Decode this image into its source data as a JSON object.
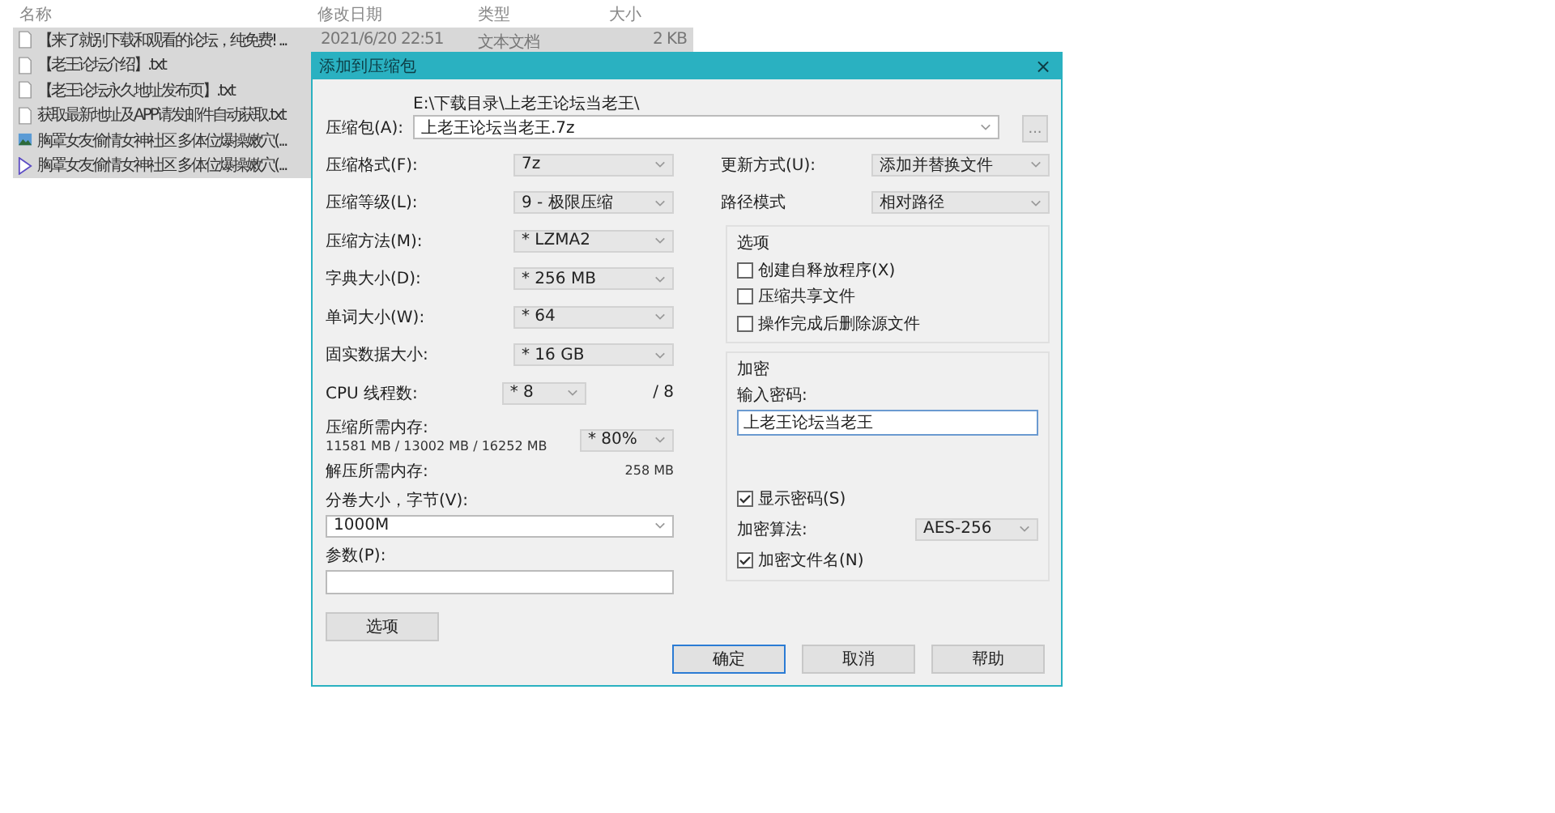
{
  "file_list": {
    "columns": [
      "名称",
      "修改日期",
      "类型",
      "大小"
    ],
    "rows": [
      {
        "name": "【来了就别下载和观看的论坛，纯免费! ...",
        "modified": "2021/6/20 22:51",
        "type": "文本文档",
        "size": "2 KB",
        "selected": true,
        "kind": "text"
      },
      {
        "name": "【老王论坛介绍】.txt",
        "selected": true,
        "kind": "text"
      },
      {
        "name": "【老王论坛永久地址发布页】.txt",
        "selected": true,
        "kind": "text"
      },
      {
        "name": "获取最新地址及APP请发邮件自动获取.txt",
        "selected": true,
        "kind": "text"
      },
      {
        "name": "胸罩女友偷情女神社区 多体位爆操嫩穴(...",
        "selected": true,
        "kind": "image"
      },
      {
        "name": "胸罩女友偷情女神社区 多体位爆操嫩穴(...",
        "selected": true,
        "kind": "video"
      }
    ]
  },
  "dialog": {
    "title": "添加到压缩包",
    "close": "×",
    "archive": {
      "label": "压缩包(A):",
      "path": "E:\\下载目录\\上老王论坛当老王\\",
      "value": "上老王论坛当老王.7z",
      "browse": "..."
    },
    "left_settings": [
      {
        "label": "压缩格式(F):",
        "value": "7z"
      },
      {
        "label": "压缩等级(L):",
        "value": "9 - 极限压缩"
      },
      {
        "label": "压缩方法(M):",
        "value": "* LZMA2"
      },
      {
        "label": "字典大小(D):",
        "value": "* 256 MB"
      },
      {
        "label": "单词大小(W):",
        "value": "* 64"
      },
      {
        "label": "固实数据大小:",
        "value": "* 16 GB"
      }
    ],
    "cpu": {
      "label": "CPU 线程数:",
      "value": "* 8",
      "max": "/ 8"
    },
    "compress_memory": {
      "label": "压缩所需内存:",
      "detail": "11581 MB / 13002 MB / 16252 MB",
      "value": "* 80%"
    },
    "decompress_memory": {
      "label": "解压所需内存:",
      "value": "258 MB"
    },
    "volume": {
      "label": "分卷大小，字节(V):",
      "value": "1000M"
    },
    "params": {
      "label": "参数(P):"
    },
    "options_button": "选项",
    "right_settings": [
      {
        "label": "更新方式(U):",
        "value": "添加并替换文件"
      },
      {
        "label": "路径模式",
        "value": "相对路径"
      }
    ],
    "options": {
      "title": "选项",
      "checkboxes": [
        {
          "label": "创建自释放程序(X)",
          "checked": false
        },
        {
          "label": "压缩共享文件",
          "checked": false
        },
        {
          "label": "操作完成后删除源文件",
          "checked": false
        }
      ]
    },
    "encryption": {
      "title": "加密",
      "password_label": "输入密码:",
      "password": "上老王论坛当老王",
      "show_password": {
        "label": "显示密码(S)",
        "checked": true
      },
      "method_label": "加密算法:",
      "method": "AES-256",
      "encrypt_names": {
        "label": "加密文件名(N)",
        "checked": true
      }
    },
    "buttons": [
      {
        "label": "确定",
        "selected": true
      },
      {
        "label": "取消",
        "selected": false
      },
      {
        "label": "帮助",
        "selected": false
      }
    ]
  }
}
